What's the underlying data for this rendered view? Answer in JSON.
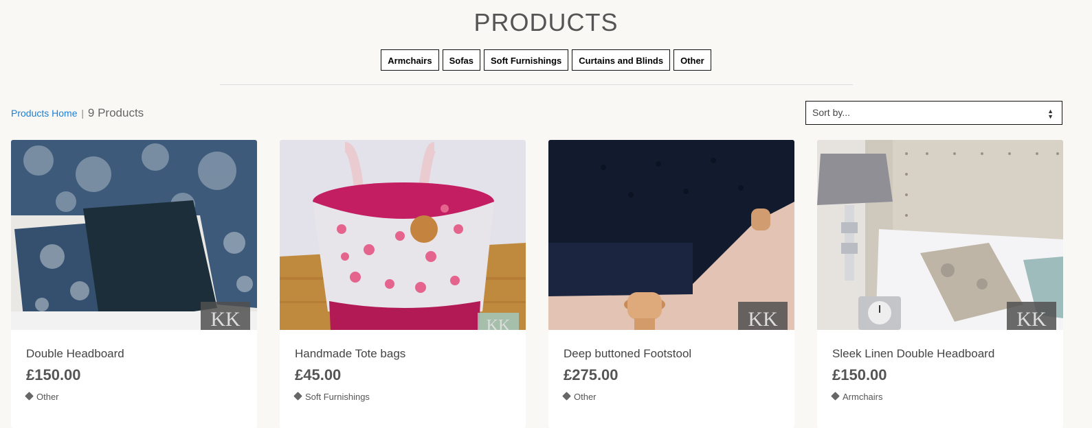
{
  "page": {
    "title": "PRODUCTS"
  },
  "categories": [
    "Armchairs",
    "Sofas",
    "Soft Furnishings",
    "Curtains and Blinds",
    "Other"
  ],
  "breadcrumb": {
    "home_link": "Products Home",
    "separator": "|",
    "count": "9 Products"
  },
  "sort": {
    "selected": "Sort by..."
  },
  "products": [
    {
      "name": "Double Headboard",
      "price": "£150.00",
      "category": "Other",
      "logo": "KK"
    },
    {
      "name": "Handmade Tote bags",
      "price": "£45.00",
      "category": "Soft Furnishings",
      "logo": "KK"
    },
    {
      "name": "Deep buttoned Footstool",
      "price": "£275.00",
      "category": "Other",
      "logo": "KK"
    },
    {
      "name": "Sleek Linen Double Headboard",
      "price": "£150.00",
      "category": "Armchairs",
      "logo": "KK"
    }
  ],
  "colors": {
    "link": "#1a7fd6",
    "background": "#f9f8f5"
  }
}
